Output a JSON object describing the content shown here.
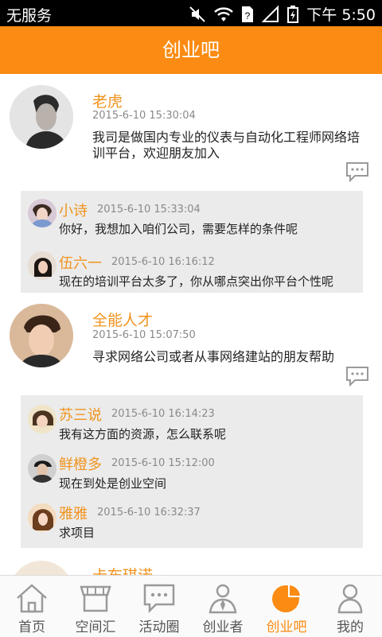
{
  "status": {
    "carrier": "无服务",
    "time": "下午 5:50"
  },
  "header": {
    "title": "创业吧"
  },
  "posts": [
    {
      "name": "老虎",
      "time": "2015-6-10 15:30:04",
      "body_line1": "我司是做国内专业的仪表与自动化工程师网络培",
      "body_line2": "训平台，欢迎朋友加入",
      "replies": [
        {
          "name": "小诗",
          "time": "2015-6-10 15:33:04",
          "body": "你好，我想加入咱们公司，需要怎样的条件呢"
        },
        {
          "name": "伍六一",
          "time": "2015-6-10 16:16:12",
          "body": "现在的培训平台太多了，你从哪点突出你平台个性呢"
        }
      ]
    },
    {
      "name": "全能人才",
      "time": "2015-6-10 15:07:50",
      "body_line1": "寻求网络公司或者从事网络建站的朋友帮助",
      "replies": [
        {
          "name": "苏三说",
          "time": "2015-6-10 16:14:23",
          "body": "我有这方面的资源，怎么联系呢"
        },
        {
          "name": "鲜橙多",
          "time": "2015-6-10 15:12:00",
          "body": "现在到处是创业空间"
        },
        {
          "name": "雅雅",
          "time": "2015-6-10 16:32:37",
          "body": "求项目"
        }
      ]
    },
    {
      "name": "卡布琪诺"
    }
  ],
  "tabs": [
    {
      "label": "首页",
      "icon": "home-icon"
    },
    {
      "label": "空间汇",
      "icon": "store-icon"
    },
    {
      "label": "活动圈",
      "icon": "chat-bubble-icon"
    },
    {
      "label": "创业者",
      "icon": "entrepreneur-icon"
    },
    {
      "label": "创业吧",
      "icon": "pie-chart-icon",
      "active": true
    },
    {
      "label": "我的",
      "icon": "user-icon"
    }
  ],
  "colors": {
    "accent": "#fb8b12",
    "name": "#f0931e",
    "reply_bg": "#ebebeb"
  }
}
